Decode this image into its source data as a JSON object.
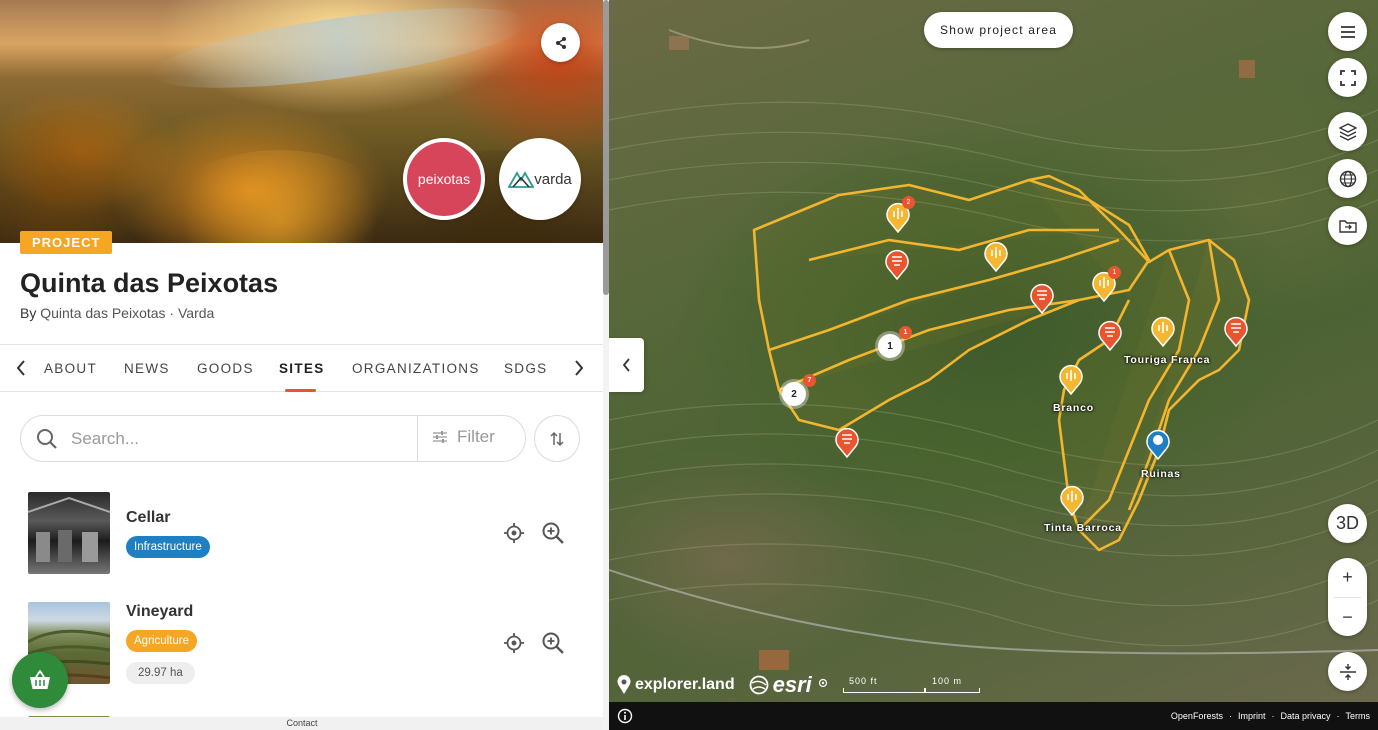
{
  "project": {
    "badge": "PROJECT",
    "title": "Quinta das Peixotas",
    "by_prefix": "By",
    "org_primary": "Quinta das Peixotas",
    "separator": "·",
    "org_secondary": "Varda",
    "logo_peixotas": "peixotas",
    "logo_varda": "varda"
  },
  "tabs": [
    "ABOUT",
    "NEWS",
    "GOODS",
    "SITES",
    "ORGANIZATIONS",
    "SDGS"
  ],
  "active_tab": "SITES",
  "search": {
    "placeholder": "Search...",
    "filter_label": "Filter"
  },
  "sites": [
    {
      "name": "Cellar",
      "category": "Infrastructure",
      "category_color": "#1e7fc2",
      "area": ""
    },
    {
      "name": "Vineyard",
      "category": "Agriculture",
      "category_color": "#f5a623",
      "area": "29.97 ha"
    }
  ],
  "footer": {
    "contact": "Contact"
  },
  "map": {
    "show_area_label": "Show project area",
    "three_d_label": "3D",
    "zoom_in": "+",
    "zoom_out": "−",
    "labels": {
      "touriga": "Touriga Franca",
      "branco": "Branco",
      "ruinas": "Ruinas",
      "tinta": "Tinta Barroca"
    },
    "clusters": [
      {
        "count": "1",
        "sub": "1"
      },
      {
        "count": "2",
        "sub": "7"
      }
    ],
    "pin_badges": [
      "2",
      "1"
    ],
    "brand_explorer": "explorer.land",
    "brand_esri": "esri",
    "scale": {
      "left": "500 ft",
      "right": "100 m"
    },
    "attribution": [
      "OpenForests",
      "Imprint",
      "Data privacy",
      "Terms"
    ],
    "attribution_sep": "·"
  },
  "colors": {
    "accent": "#e8552f",
    "project_badge": "#f5a623",
    "boundary": "#f2b52e",
    "fab": "#2f8a3a",
    "pin_red": "#e8552f",
    "pin_yellow": "#f5b731",
    "pin_blue": "#1e7fc2"
  }
}
